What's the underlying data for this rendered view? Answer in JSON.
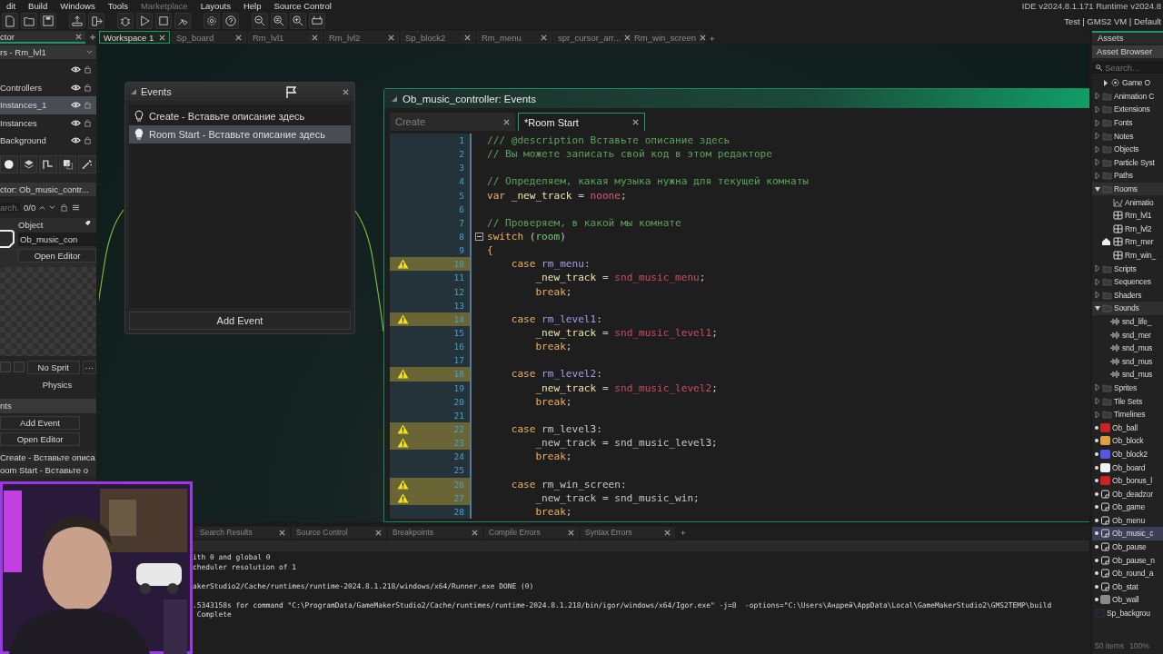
{
  "menu": [
    {
      "label": "dit",
      "disabled": false
    },
    {
      "label": "Build",
      "disabled": false
    },
    {
      "label": "Windows",
      "disabled": false
    },
    {
      "label": "Tools",
      "disabled": false
    },
    {
      "label": "Marketplace",
      "disabled": true
    },
    {
      "label": "Layouts",
      "disabled": false
    },
    {
      "label": "Help",
      "disabled": false
    },
    {
      "label": "Source Control",
      "disabled": false
    }
  ],
  "version": "IDE v2024.8.1.171  Runtime v2024.8",
  "build_target": "Test | GMS2 VM | Default",
  "left_panel": {
    "tab": "ctor",
    "layers_header": "rs - Rm_lvl1",
    "layers": [
      {
        "selected": false
      },
      {
        "name": "Controllers",
        "selected": false
      },
      {
        "name": "Instances_1",
        "selected": true
      },
      {
        "name": "Instances",
        "selected": false
      },
      {
        "name": "Background",
        "selected": false
      }
    ],
    "inspector_header": "ctor: Ob_music_contr...",
    "search_placeholder": "arch.",
    "match_count": "0/0",
    "object_label": "Object",
    "object_name": "Ob_music_con",
    "open_editor": "Open Editor",
    "sprite_button": "No Sprit",
    "sprite_more": "···",
    "physics": "Physics",
    "events_header": "nts",
    "add_event": "Add Event",
    "open_editor_2": "Open Editor",
    "events": [
      {
        "label": "Create - Вставьте описа",
        "selected": false
      },
      {
        "label": "oom Start - Вставьте о",
        "selected": false
      }
    ]
  },
  "workspace_tabs": [
    {
      "label": "Workspace 1",
      "selected": true
    },
    {
      "label": "Sp_board",
      "selected": false
    },
    {
      "label": "Rm_lvl1",
      "selected": false
    },
    {
      "label": "Rm_lvl2",
      "selected": false
    },
    {
      "label": "Sp_block2",
      "selected": false
    },
    {
      "label": "Rm_menu",
      "selected": false
    },
    {
      "label": "spr_cursor_arr...",
      "selected": false
    },
    {
      "label": "Rm_win_screen",
      "selected": false
    }
  ],
  "workspace_add": "+",
  "events_window": {
    "title": "Events",
    "items": [
      {
        "label": "Create - Вставьте описание здесь",
        "selected": false
      },
      {
        "label": "Room Start - Вставьте описание здесь",
        "selected": true
      }
    ],
    "add_event": "Add Event"
  },
  "code_window": {
    "title": "Ob_music_controller: Events",
    "tabs": [
      {
        "label": "Create",
        "selected": false
      },
      {
        "label": "*Room Start",
        "selected": true
      }
    ],
    "lines": [
      {
        "number": "1",
        "warning": false,
        "fold": false,
        "tokens": [
          {
            "text": "/// @description Вставьте описание здесь",
            "kind": "comment"
          }
        ]
      },
      {
        "number": "2",
        "warning": false,
        "fold": false,
        "tokens": [
          {
            "text": "// Вы можете записать свой код в этом редакторе",
            "kind": "comment"
          }
        ]
      },
      {
        "number": "3",
        "warning": false,
        "fold": false
      },
      {
        "number": "4",
        "warning": false,
        "fold": false,
        "tokens": [
          {
            "text": "// Определяем, какая музыка нужна для текущей комнаты",
            "kind": "comment"
          }
        ]
      },
      {
        "number": "5",
        "warning": false,
        "fold": false,
        "tokens": [
          {
            "text": "var",
            "kind": "keyword"
          },
          {
            "text": " _new_track",
            "kind": "local"
          },
          {
            "text": " = ",
            "kind": "plain"
          },
          {
            "text": "noone",
            "kind": "constant"
          },
          {
            "text": ";",
            "kind": "plain"
          }
        ]
      },
      {
        "number": "6",
        "warning": false,
        "fold": false
      },
      {
        "number": "7",
        "warning": false,
        "fold": false,
        "tokens": [
          {
            "text": "// Проверяем, в какой мы комнате",
            "kind": "comment"
          }
        ]
      },
      {
        "number": "8",
        "warning": false,
        "fold": true,
        "tokens": [
          {
            "text": "switch",
            "kind": "keyword"
          },
          {
            "text": " (",
            "kind": "plain"
          },
          {
            "text": "room",
            "kind": "builtin"
          },
          {
            "text": ")",
            "kind": "plain"
          }
        ]
      },
      {
        "number": "9",
        "warning": false,
        "fold": false,
        "tokens": [
          {
            "text": "{",
            "kind": "keyword"
          }
        ]
      },
      {
        "number": "10",
        "warning": true,
        "fold": false,
        "tokens": [
          {
            "text": "    case",
            "kind": "keyword"
          },
          {
            "text": " rm_menu",
            "kind": "room"
          },
          {
            "text": ":",
            "kind": "plain"
          }
        ]
      },
      {
        "number": "11",
        "warning": false,
        "fold": false,
        "tokens": [
          {
            "text": "        _new_track",
            "kind": "local"
          },
          {
            "text": " = ",
            "kind": "plain"
          },
          {
            "text": "snd_music_menu",
            "kind": "sound"
          },
          {
            "text": ";",
            "kind": "plain"
          }
        ]
      },
      {
        "number": "12",
        "warning": false,
        "fold": false,
        "tokens": [
          {
            "text": "        break",
            "kind": "keyword"
          },
          {
            "text": ";",
            "kind": "plain"
          }
        ]
      },
      {
        "number": "13",
        "warning": false,
        "fold": false
      },
      {
        "number": "14",
        "warning": true,
        "fold": false,
        "tokens": [
          {
            "text": "    case",
            "kind": "keyword"
          },
          {
            "text": " rm_level1",
            "kind": "room"
          },
          {
            "text": ":",
            "kind": "plain"
          }
        ]
      },
      {
        "number": "15",
        "warning": false,
        "fold": false,
        "tokens": [
          {
            "text": "        _new_track",
            "kind": "local"
          },
          {
            "text": " = ",
            "kind": "plain"
          },
          {
            "text": "snd_music_level1",
            "kind": "sound"
          },
          {
            "text": ";",
            "kind": "plain"
          }
        ]
      },
      {
        "number": "16",
        "warning": false,
        "fold": false,
        "tokens": [
          {
            "text": "        break",
            "kind": "keyword"
          },
          {
            "text": ";",
            "kind": "plain"
          }
        ]
      },
      {
        "number": "17",
        "warning": false,
        "fold": false
      },
      {
        "number": "18",
        "warning": true,
        "fold": false,
        "tokens": [
          {
            "text": "    case",
            "kind": "keyword"
          },
          {
            "text": " rm_level2",
            "kind": "room"
          },
          {
            "text": ":",
            "kind": "plain"
          }
        ]
      },
      {
        "number": "19",
        "warning": false,
        "fold": false,
        "tokens": [
          {
            "text": "        _new_track",
            "kind": "local"
          },
          {
            "text": " = ",
            "kind": "plain"
          },
          {
            "text": "snd_music_level2",
            "kind": "sound"
          },
          {
            "text": ";",
            "kind": "plain"
          }
        ]
      },
      {
        "number": "20",
        "warning": false,
        "fold": false,
        "tokens": [
          {
            "text": "        break",
            "kind": "keyword"
          },
          {
            "text": ";",
            "kind": "plain"
          }
        ]
      },
      {
        "number": "21",
        "warning": false,
        "fold": false
      },
      {
        "number": "22",
        "warning": true,
        "fold": false,
        "tokens": [
          {
            "text": "    case",
            "kind": "keyword"
          },
          {
            "text": " rm_level3:",
            "kind": "plain"
          }
        ]
      },
      {
        "number": "23",
        "warning": true,
        "fold": false,
        "tokens": [
          {
            "text": "        _new_track = snd_music_level3;",
            "kind": "plain"
          }
        ]
      },
      {
        "number": "24",
        "warning": false,
        "fold": false,
        "tokens": [
          {
            "text": "        break",
            "kind": "keyword"
          },
          {
            "text": ";",
            "kind": "plain"
          }
        ]
      },
      {
        "number": "25",
        "warning": false,
        "fold": false
      },
      {
        "number": "26",
        "warning": true,
        "fold": false,
        "tokens": [
          {
            "text": "    case",
            "kind": "keyword"
          },
          {
            "text": " rm_win_screen:",
            "kind": "plain"
          }
        ]
      },
      {
        "number": "27",
        "warning": true,
        "fold": false,
        "tokens": [
          {
            "text": "        _new_track = snd_music_win;",
            "kind": "plain"
          }
        ]
      },
      {
        "number": "28",
        "warning": false,
        "fold": false,
        "tokens": [
          {
            "text": "        break",
            "kind": "keyword"
          },
          {
            "text": ";",
            "kind": "plain"
          }
        ]
      }
    ]
  },
  "output": {
    "tabs": [
      {
        "label": "Search Results",
        "selected": false
      },
      {
        "label": "Source Control",
        "selected": false
      },
      {
        "label": "Breakpoints",
        "selected": false
      },
      {
        "label": "Compile Errors",
        "selected": false
      },
      {
        "label": "Syntax Errors",
        "selected": false
      }
    ],
    "add": "+",
    "blocks": [
      {
        "lines": [
          "ith 0 and global 0",
          "cheduler resolution of 1"
        ]
      },
      {
        "lines": [
          "akerStudio2/Cache/runtimes/runtime-2024.8.1.218/windows/x64/Runner.exe DONE (0)"
        ]
      },
      {
        "lines": [
          ".5343158s for command \"C:\\ProgramData/GameMakerStudio2/Cache/runtimes/runtime-2024.8.1.218/bin/igor/windows/x64/Igor.exe\" -j=8  -options=\"C:\\Users\\Андрей\\AppData\\Local\\GameMakerStudio2\\GMS2TEMP\\build",
          " Complete"
        ]
      }
    ]
  },
  "assets": {
    "tab": "Assets",
    "header": "Asset Browser",
    "search_placeholder": "Search...",
    "tree": [
      {
        "label": "Game O",
        "kind": "options",
        "selected": false
      },
      {
        "label": "Animation C",
        "kind": "folder",
        "expanded": false,
        "selected": false
      },
      {
        "label": "Extensions",
        "kind": "folder",
        "expanded": false,
        "selected": false
      },
      {
        "label": "Fonts",
        "kind": "folder",
        "expanded": false,
        "selected": false
      },
      {
        "label": "Notes",
        "kind": "folder",
        "expanded": false,
        "selected": false
      },
      {
        "label": "Objects",
        "kind": "folder",
        "expanded": false,
        "selected": false
      },
      {
        "label": "Particle Syst",
        "kind": "folder",
        "expanded": false,
        "selected": false
      },
      {
        "label": "Paths",
        "kind": "folder",
        "expanded": false,
        "selected": false
      },
      {
        "label": "Rooms",
        "kind": "folder",
        "expanded": true,
        "selected": false,
        "children": [
          {
            "label": "Animatio",
            "kind": "curve",
            "selected": false
          },
          {
            "label": "Rm_lvl1",
            "kind": "room",
            "home": false,
            "selected": false
          },
          {
            "label": "Rm_lvl2",
            "kind": "room",
            "home": false,
            "selected": false
          },
          {
            "label": "Rm_mer",
            "kind": "room",
            "home": true,
            "selected": false
          },
          {
            "label": "Rm_win_",
            "kind": "room",
            "home": false,
            "selected": false
          }
        ]
      },
      {
        "label": "Scripts",
        "kind": "folder",
        "expanded": false,
        "selected": false
      },
      {
        "label": "Sequences",
        "kind": "folder",
        "expanded": false,
        "selected": false
      },
      {
        "label": "Shaders",
        "kind": "folder",
        "expanded": false,
        "selected": false
      },
      {
        "label": "Sounds",
        "kind": "folder",
        "expanded": true,
        "selected": false,
        "children": [
          {
            "label": "snd_life_",
            "kind": "sound",
            "selected": false
          },
          {
            "label": "snd_mer",
            "kind": "sound",
            "selected": false
          },
          {
            "label": "snd_mus",
            "kind": "sound",
            "selected": false
          },
          {
            "label": "snd_mus",
            "kind": "sound",
            "selected": false
          },
          {
            "label": "snd_mus",
            "kind": "sound",
            "selected": false
          }
        ]
      },
      {
        "label": "Sprites",
        "kind": "folder",
        "expanded": false,
        "selected": false
      },
      {
        "label": "Tile Sets",
        "kind": "folder",
        "expanded": false,
        "selected": false
      },
      {
        "label": "Timelines",
        "kind": "folder",
        "expanded": false,
        "selected": false
      },
      {
        "label": "Ob_ball",
        "kind": "object",
        "color": "#cc2222",
        "selected": false
      },
      {
        "label": "Ob_block",
        "kind": "object",
        "color": "#e0a040",
        "selected": false
      },
      {
        "label": "Ob_block2",
        "kind": "object",
        "color": "#5555e6",
        "selected": false
      },
      {
        "label": "Ob_board",
        "kind": "object",
        "color": "#f2f2f2",
        "selected": false
      },
      {
        "label": "Ob_bonus_l",
        "kind": "object",
        "color": "#cc2222",
        "selected": false
      },
      {
        "label": "Ob_deadzor",
        "kind": "object",
        "selected": false
      },
      {
        "label": "Ob_game",
        "kind": "object",
        "selected": false
      },
      {
        "label": "Ob_menu",
        "kind": "object",
        "selected": false
      },
      {
        "label": "Ob_music_c",
        "kind": "object",
        "selected": true
      },
      {
        "label": "Ob_pause",
        "kind": "object",
        "selected": false
      },
      {
        "label": "Ob_pause_n",
        "kind": "object",
        "selected": false
      },
      {
        "label": "Ob_round_a",
        "kind": "object",
        "selected": false
      },
      {
        "label": "Ob_stat",
        "kind": "object",
        "selected": false
      },
      {
        "label": "Ob_wall",
        "kind": "object",
        "color": "#8a8a8a",
        "selected": false
      },
      {
        "label": "Sp_backgrou",
        "kind": "sprite",
        "selected": false
      }
    ],
    "count": "50 items",
    "zoom": "100%"
  }
}
